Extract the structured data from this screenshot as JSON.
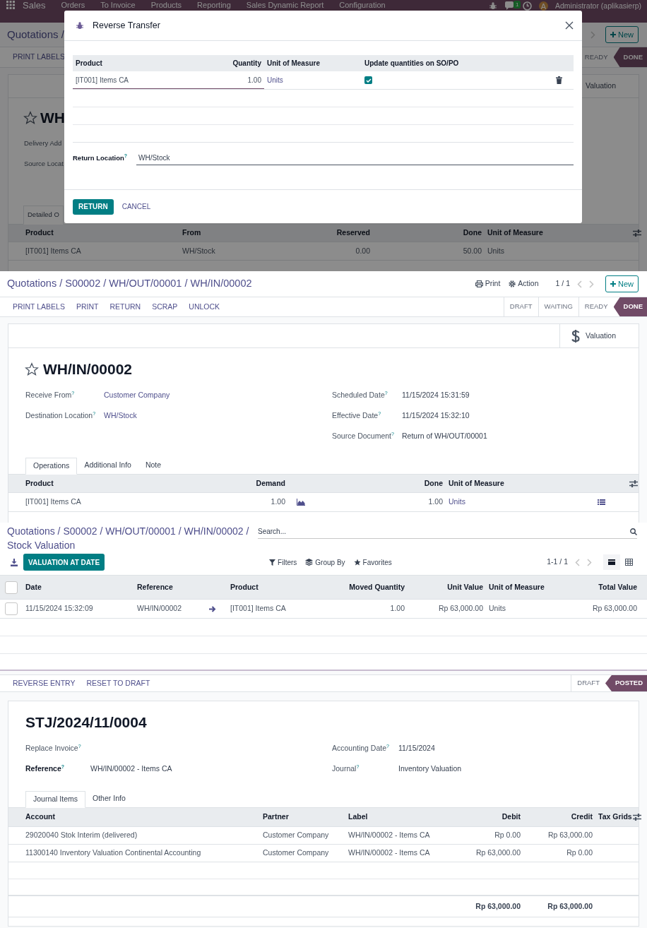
{
  "screen_1": {
    "navbar": {
      "app": "Sales",
      "menu": [
        "Orders",
        "To Invoice",
        "Products",
        "Reporting",
        "Sales Dynamic Report",
        "Configuration"
      ],
      "notification_count": "1",
      "avatar_initial": "A",
      "user": "Administrator (aplikasierp)"
    },
    "breadcrumb": "Quotations /",
    "new_button": "New",
    "actions": [
      "PRINT LABELS"
    ],
    "statusbar": [
      {
        "label": "READY",
        "selected": false
      },
      {
        "label": "DONE",
        "selected": true
      }
    ],
    "valuation_button": "Valuation",
    "title": "WH",
    "fields": [
      {
        "label": "Delivery Add"
      },
      {
        "label": "Source Locat"
      }
    ],
    "tabs": [
      {
        "label": "Detailed O",
        "selected": true
      }
    ],
    "table": {
      "columns": [
        "Product",
        "From",
        "Reserved",
        "Done",
        "Unit of Measure"
      ],
      "rows": [
        [
          "[IT001] Items CA",
          "WH/Stock",
          "0.00",
          "50.00",
          "Units"
        ]
      ]
    },
    "dialog": {
      "title": "Reverse Transfer",
      "columns": [
        "Product",
        "Quantity",
        "Unit of Measure",
        "Update quantities on SO/PO"
      ],
      "rows": [
        {
          "product": "[IT001] Items CA",
          "quantity": "1.00",
          "unit": "Units",
          "update": true
        }
      ],
      "return_location_label": "Return Location$^{?}$",
      "return_location": "WH/Stock",
      "buttons": [
        "RETURN",
        "CANCEL"
      ]
    }
  },
  "screen_2": {
    "breadcrumb": "Quotations / S00002 / WH/OUT/00001 / WH/IN/00002",
    "print_button": "Print",
    "action_button": "Action",
    "pager": "1 / 1",
    "new_button": "New",
    "actions": [
      "PRINT LABELS",
      "PRINT",
      "RETURN",
      "SCRAP",
      "UNLOCK"
    ],
    "statusbar": [
      {
        "label": "DRAFT",
        "selected": false
      },
      {
        "label": "WAITING",
        "selected": false
      },
      {
        "label": "READY",
        "selected": false
      },
      {
        "label": "DONE",
        "selected": true
      }
    ],
    "valuation_button": "Valuation",
    "title": "WH/IN/00002",
    "fields_left": [
      {
        "label": "Receive From$^{?}$",
        "value": "Customer Company",
        "link": true
      },
      {
        "label": "Destination Location$^{?}$",
        "value": "WH/Stock",
        "link": true
      }
    ],
    "fields_right": [
      {
        "label": "Scheduled Date$^{?}$",
        "value": "11/15/2024 15:31:59",
        "link": false
      },
      {
        "label": "Effective Date$^{?}$",
        "value": "11/15/2024 15:32:10",
        "link": false
      },
      {
        "label": "Source Document$^{?}$",
        "value": "Return of WH/OUT/00001",
        "link": false
      }
    ],
    "tabs": [
      {
        "label": "Operations",
        "selected": true
      },
      {
        "label": "Additional Info",
        "selected": false
      },
      {
        "label": "Note",
        "selected": false
      }
    ],
    "table": {
      "columns": [
        "Product",
        "Demand",
        "Done",
        "Unit of Measure"
      ],
      "rows": [
        [
          "[IT001] Items CA",
          "1.00",
          "1.00",
          "Units"
        ]
      ]
    }
  },
  "screen_3": {
    "breadcrumb": "Quotations / S00002 / WH/OUT/00001 / WH/IN/00002 / Stock Valuation",
    "search": {
      "placeholder": "Search..."
    },
    "primary_button": "VALUATION AT DATE",
    "filters": [
      "Filters",
      "Group By",
      "Favorites"
    ],
    "pager": "1-1 / 1",
    "select_all": false,
    "table": {
      "columns": [
        "Date",
        "Reference",
        "Product",
        "Moved Quantity",
        "Unit Value",
        "Unit of Measure",
        "Total Value"
      ],
      "rows": [
        {
          "selected": false,
          "cells": [
            "11/15/2024 15:32:09",
            "WH/IN/00002",
            "[IT001] Items CA",
            "1.00",
            "Rp 63,000.00",
            "Units",
            "Rp 63,000.00"
          ]
        }
      ]
    }
  },
  "screen_4": {
    "actions": [
      "REVERSE ENTRY",
      "RESET TO DRAFT"
    ],
    "statusbar": [
      {
        "label": "DRAFT",
        "selected": false
      },
      {
        "label": "POSTED",
        "selected": true
      }
    ],
    "title": "STJ/2024/11/0004",
    "fields_left": [
      {
        "label": "Replace Invoice$^{?}$",
        "bold": false
      },
      {
        "label": "Reference$^{?}$",
        "value": "WH/IN/00002 - Items CA",
        "bold": true,
        "link": false
      }
    ],
    "fields_right": [
      {
        "label": "Accounting Date$^{?}$",
        "value": "11/15/2024",
        "bold": false,
        "link": false
      },
      {
        "label": "Journal$^{?}$",
        "value": "Inventory Valuation",
        "bold": false,
        "link": false
      }
    ],
    "tabs": [
      {
        "label": "Journal Items",
        "selected": true
      },
      {
        "label": "Other Info",
        "selected": false
      }
    ],
    "table": {
      "columns": [
        "Account",
        "Partner",
        "Label",
        "Debit",
        "Credit",
        "Tax Grids"
      ],
      "rows": [
        [
          "29020040 Stok Interim (delivered)",
          "Customer Company",
          "WH/IN/00002 - Items CA",
          "Rp 0.00",
          "Rp 63,000.00"
        ],
        [
          "11300140 Inventory Valuation Continental Accounting",
          "Customer Company",
          "WH/IN/00002 - Items CA",
          "Rp 63,000.00",
          "Rp 0.00"
        ]
      ],
      "totals": [
        "Rp 63,000.00",
        "Rp 63,000.00"
      ]
    }
  }
}
